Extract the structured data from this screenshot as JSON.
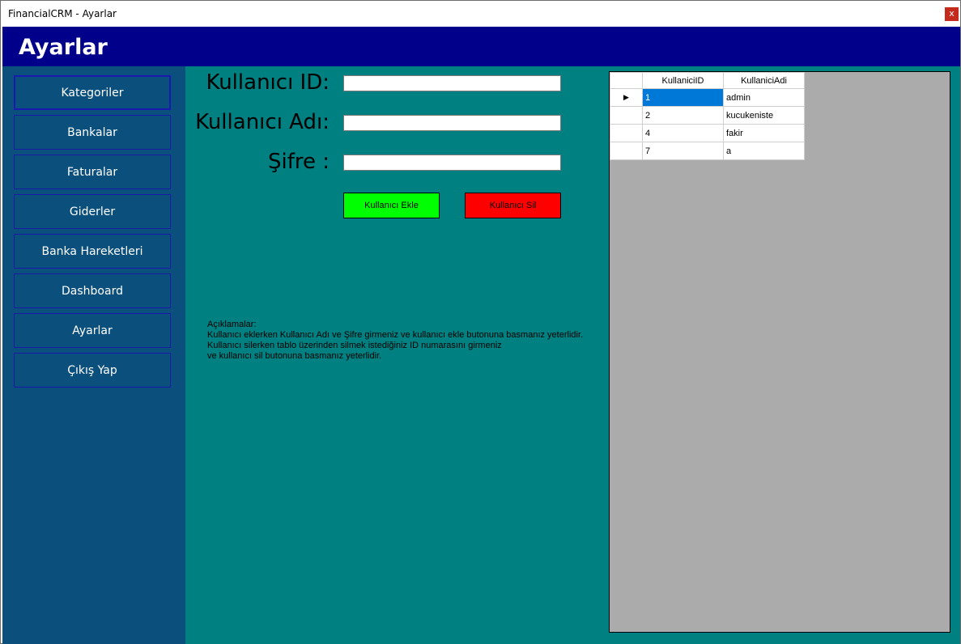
{
  "window": {
    "title": "FinancialCRM - Ayarlar",
    "close_glyph": "x"
  },
  "header": {
    "title": "Ayarlar"
  },
  "sidebar": {
    "items": [
      {
        "label": "Kategoriler"
      },
      {
        "label": "Bankalar"
      },
      {
        "label": "Faturalar"
      },
      {
        "label": "Giderler"
      },
      {
        "label": "Banka Hareketleri"
      },
      {
        "label": "Dashboard"
      },
      {
        "label": "Ayarlar"
      },
      {
        "label": "Çıkış Yap"
      }
    ]
  },
  "form": {
    "id_label": "Kullanıcı ID:",
    "name_label": "Kullanıcı Adı:",
    "password_label": "Şifre :",
    "id_value": "",
    "name_value": "",
    "password_value": "",
    "add_button": "Kullanıcı Ekle",
    "delete_button": "Kullanıcı Sil"
  },
  "description": {
    "lines": [
      "Açıklamalar:",
      "Kullanıcı eklerken Kullanıcı Adı ve Şifre girmeniz ve kullanıcı ekle butonuna basmanız yeterlidir.",
      "Kullanıcı silerken tablo üzerinden silmek istediğiniz ID numarasını girmeniz",
      "ve kullanıcı sil butonuna basmanız yeterlidir."
    ]
  },
  "grid": {
    "columns": [
      "KullaniciID",
      "KullaniciAdi"
    ],
    "rows": [
      {
        "id": "1",
        "name": "admin"
      },
      {
        "id": "2",
        "name": "kucukeniste"
      },
      {
        "id": "4",
        "name": "fakir"
      },
      {
        "id": "7",
        "name": "a"
      }
    ],
    "current_row_glyph": "▶"
  },
  "colors": {
    "header": "#00008b",
    "sidebar": "#0b4f7c",
    "main": "#008080",
    "add_button": "#00ff00",
    "delete_button": "#ff0000",
    "selection": "#0078d7"
  }
}
